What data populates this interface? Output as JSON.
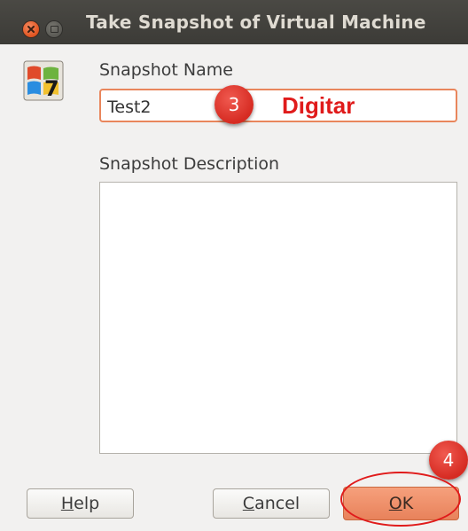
{
  "window": {
    "title": "Take Snapshot of Virtual Machine"
  },
  "form": {
    "name_label": "Snapshot Name",
    "name_value": "Test2",
    "description_label": "Snapshot Description",
    "description_value": ""
  },
  "annotations": {
    "step3_number": "3",
    "step3_text": "Digitar",
    "step4_number": "4"
  },
  "buttons": {
    "help_mnemonic": "H",
    "help_rest": "elp",
    "cancel_mnemonic": "C",
    "cancel_rest": "ancel",
    "ok_mnemonic": "O",
    "ok_rest": "K"
  },
  "icons": {
    "vm_icon": "windows7-os-icon",
    "close": "close-icon",
    "minimize": "minimize-icon"
  },
  "colors": {
    "titlebar": "#3c3b37",
    "accent_orange": "#e9865c",
    "annotation_red": "#e01b1b"
  }
}
